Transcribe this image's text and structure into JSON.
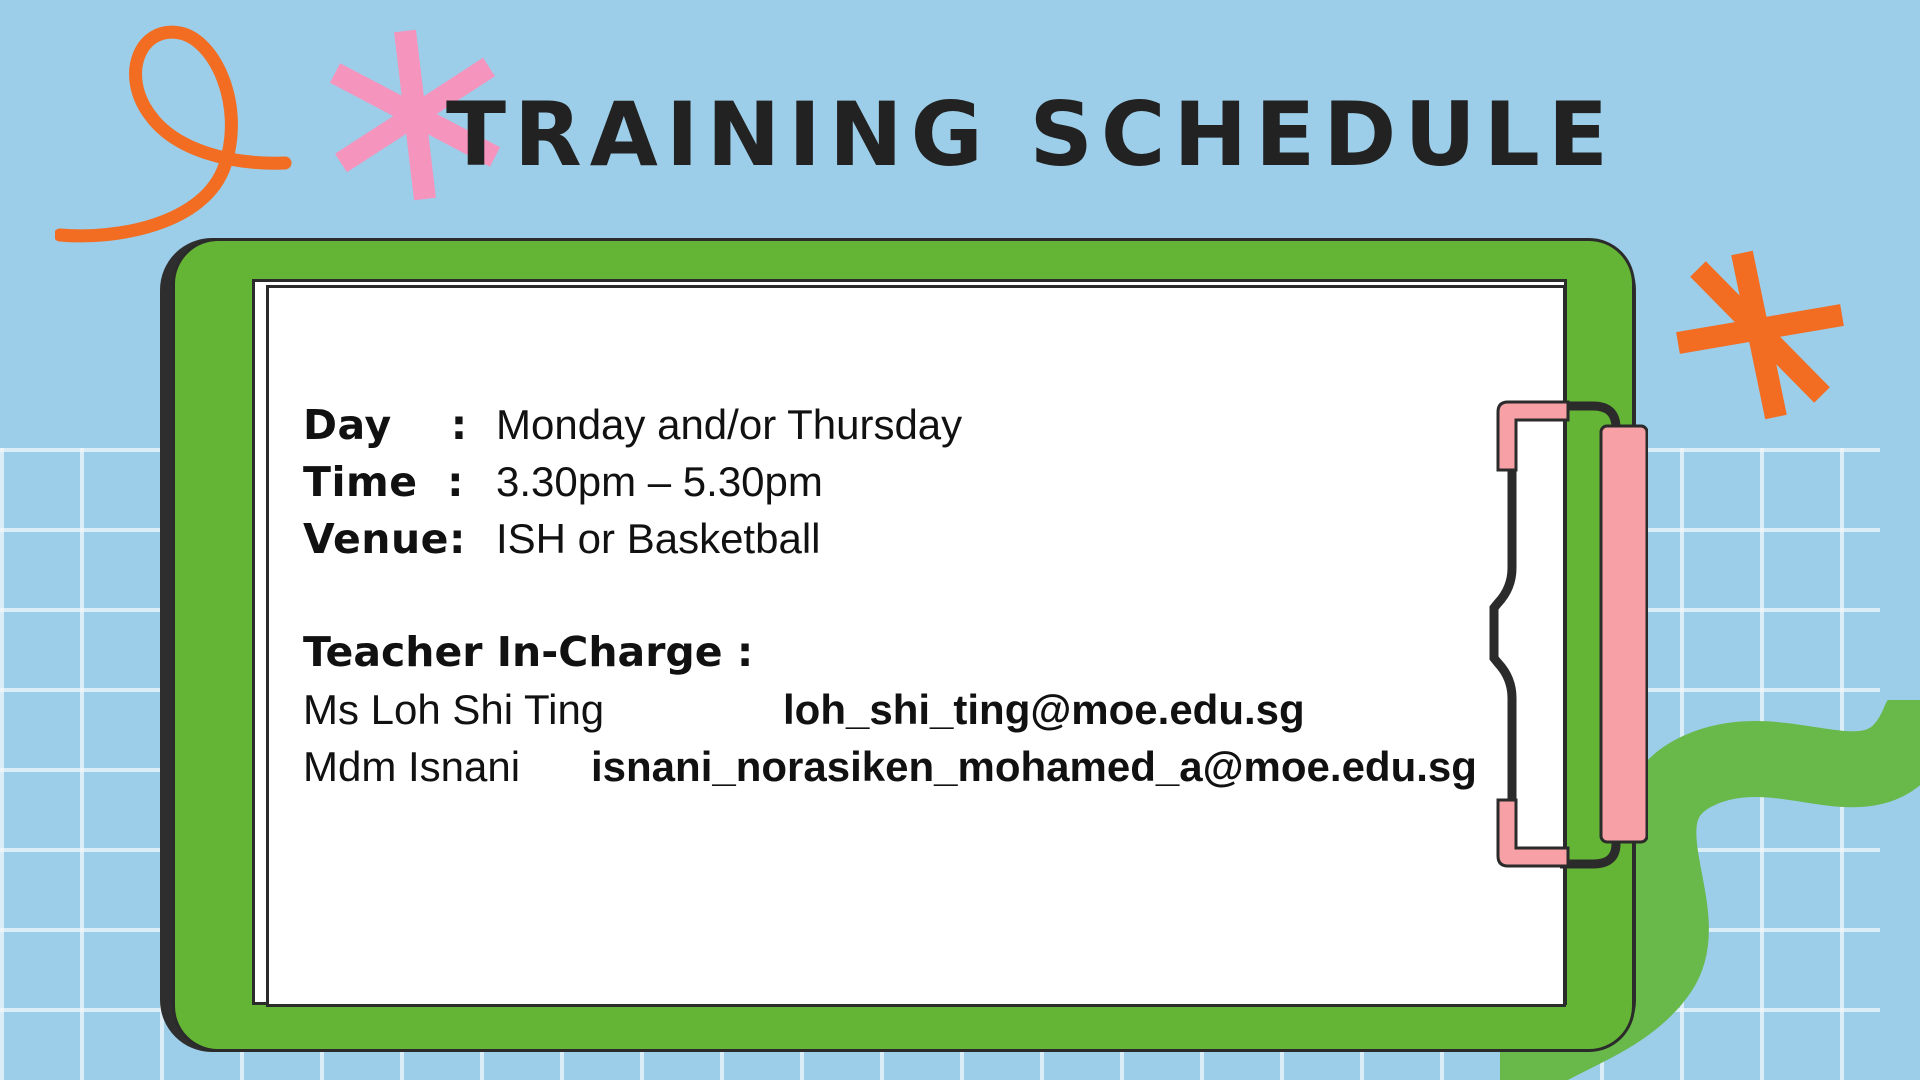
{
  "title": "TRAINING SCHEDULE",
  "schedule": {
    "day": {
      "label": "Day",
      "colon": ":",
      "value": "Monday and/or Thursday"
    },
    "time": {
      "label": "Time",
      "colon": ":",
      "value": "3.30pm – 5.30pm"
    },
    "venue": {
      "label": "Venue:",
      "colon": "",
      "value": "ISH or Basketball"
    }
  },
  "teachers": {
    "heading": "Teacher In-Charge :",
    "items": [
      {
        "name": "Ms Loh Shi Ting",
        "email": "loh_shi_ting@moe.edu.sg"
      },
      {
        "name": "Mdm Isnani",
        "email": "isnani_norasiken_mohamed_a@moe.edu.sg"
      }
    ]
  },
  "colors": {
    "background": "#9ccde9",
    "board": "#64b535",
    "orange": "#f26d21",
    "pink": "#f595bd",
    "clip_pink": "#f7a1a7",
    "squiggle": "#68b84a"
  },
  "decorations": [
    "orange-loop-icon",
    "pink-asterisk-icon",
    "orange-asterisk-icon",
    "green-squiggle-icon",
    "clipboard-clip-icon"
  ]
}
